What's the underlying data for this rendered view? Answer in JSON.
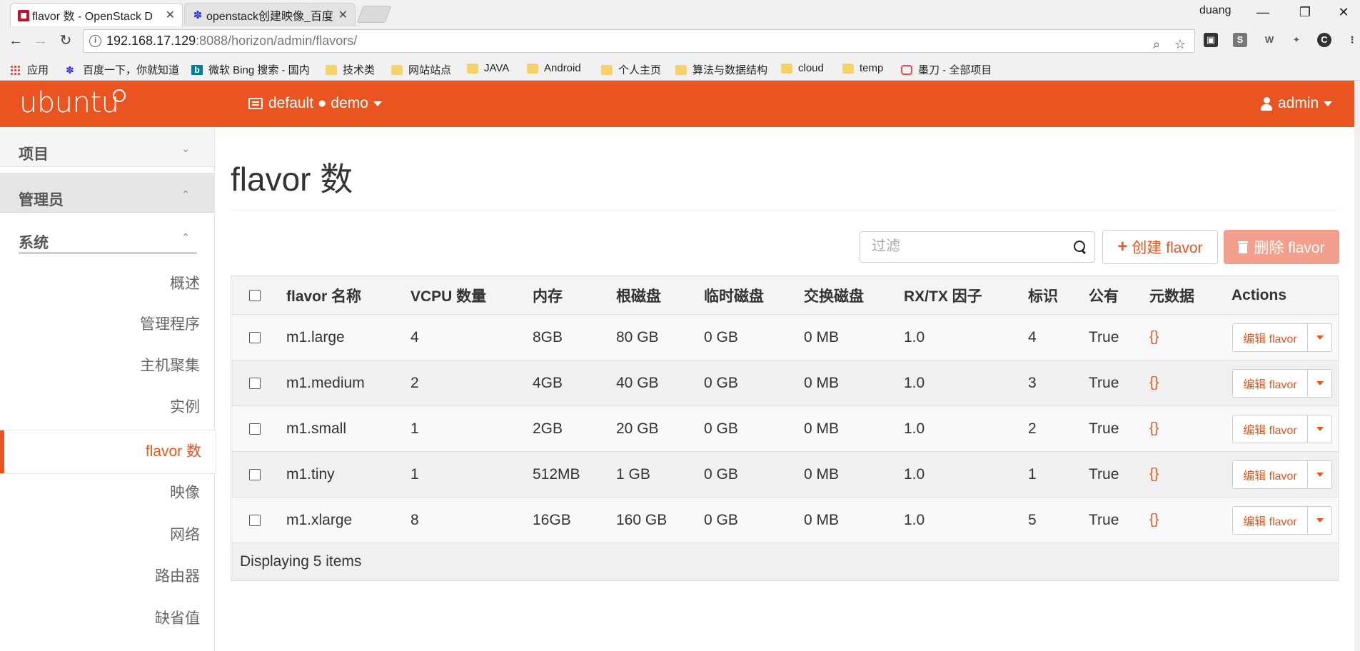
{
  "browser": {
    "tabs": [
      {
        "title": "flavor 数 - OpenStack D",
        "favicon": "openstack-icon"
      },
      {
        "title": "openstack创建映像_百度",
        "favicon": "baidu-icon"
      }
    ],
    "window_user": "duang",
    "url_host": "192.168.17.129",
    "url_rest": ":8088/horizon/admin/flavors/",
    "bookmarks": [
      {
        "label": "应用",
        "icon": "apps-grid-icon"
      },
      {
        "label": "百度一下，你就知道",
        "icon": "baidu-icon"
      },
      {
        "label": "微软 Bing 搜索 - 国内",
        "icon": "bing-icon"
      },
      {
        "label": "技术类",
        "icon": "folder-icon"
      },
      {
        "label": "网站站点",
        "icon": "folder-icon"
      },
      {
        "label": "JAVA",
        "icon": "folder-icon"
      },
      {
        "label": "Android",
        "icon": "folder-icon"
      },
      {
        "label": "个人主页",
        "icon": "folder-icon"
      },
      {
        "label": "算法与数据结构",
        "icon": "folder-icon"
      },
      {
        "label": "cloud",
        "icon": "folder-icon"
      },
      {
        "label": "temp",
        "icon": "folder-icon"
      },
      {
        "label": "墨刀 - 全部项目",
        "icon": "modao-icon"
      }
    ]
  },
  "header": {
    "brand": "ubuntu",
    "project_selector": "default ● demo",
    "user": "admin",
    "accent": "#e95420"
  },
  "sidebar": {
    "project": "项目",
    "admin": "管理员",
    "system": "系统",
    "items": [
      {
        "label": "概述",
        "active": false
      },
      {
        "label": "管理程序",
        "active": false
      },
      {
        "label": "主机聚集",
        "active": false
      },
      {
        "label": "实例",
        "active": false
      },
      {
        "label": "flavor 数",
        "active": true
      },
      {
        "label": "映像",
        "active": false
      },
      {
        "label": "网络",
        "active": false
      },
      {
        "label": "路由器",
        "active": false
      },
      {
        "label": "缺省值",
        "active": false
      }
    ]
  },
  "main": {
    "title": "flavor 数",
    "filter_placeholder": "过滤",
    "create_label": "创建 flavor",
    "delete_label": "删除 flavor",
    "columns": [
      "flavor 名称",
      "VCPU 数量",
      "内存",
      "根磁盘",
      "临时磁盘",
      "交换磁盘",
      "RX/TX 因子",
      "标识",
      "公有",
      "元数据",
      "Actions"
    ],
    "rows": [
      {
        "name": "m1.large",
        "vcpu": "4",
        "ram": "8GB",
        "root": "80 GB",
        "ephemeral": "0 GB",
        "swap": "0 MB",
        "rxtx": "1.0",
        "id": "4",
        "public": "True",
        "meta": "{}",
        "action": "编辑 flavor"
      },
      {
        "name": "m1.medium",
        "vcpu": "2",
        "ram": "4GB",
        "root": "40 GB",
        "ephemeral": "0 GB",
        "swap": "0 MB",
        "rxtx": "1.0",
        "id": "3",
        "public": "True",
        "meta": "{}",
        "action": "编辑 flavor"
      },
      {
        "name": "m1.small",
        "vcpu": "1",
        "ram": "2GB",
        "root": "20 GB",
        "ephemeral": "0 GB",
        "swap": "0 MB",
        "rxtx": "1.0",
        "id": "2",
        "public": "True",
        "meta": "{}",
        "action": "编辑 flavor"
      },
      {
        "name": "m1.tiny",
        "vcpu": "1",
        "ram": "512MB",
        "root": "1 GB",
        "ephemeral": "0 GB",
        "swap": "0 MB",
        "rxtx": "1.0",
        "id": "1",
        "public": "True",
        "meta": "{}",
        "action": "编辑 flavor"
      },
      {
        "name": "m1.xlarge",
        "vcpu": "8",
        "ram": "16GB",
        "root": "160 GB",
        "ephemeral": "0 GB",
        "swap": "0 MB",
        "rxtx": "1.0",
        "id": "5",
        "public": "True",
        "meta": "{}",
        "action": "编辑 flavor"
      }
    ],
    "footer": "Displaying 5 items"
  }
}
